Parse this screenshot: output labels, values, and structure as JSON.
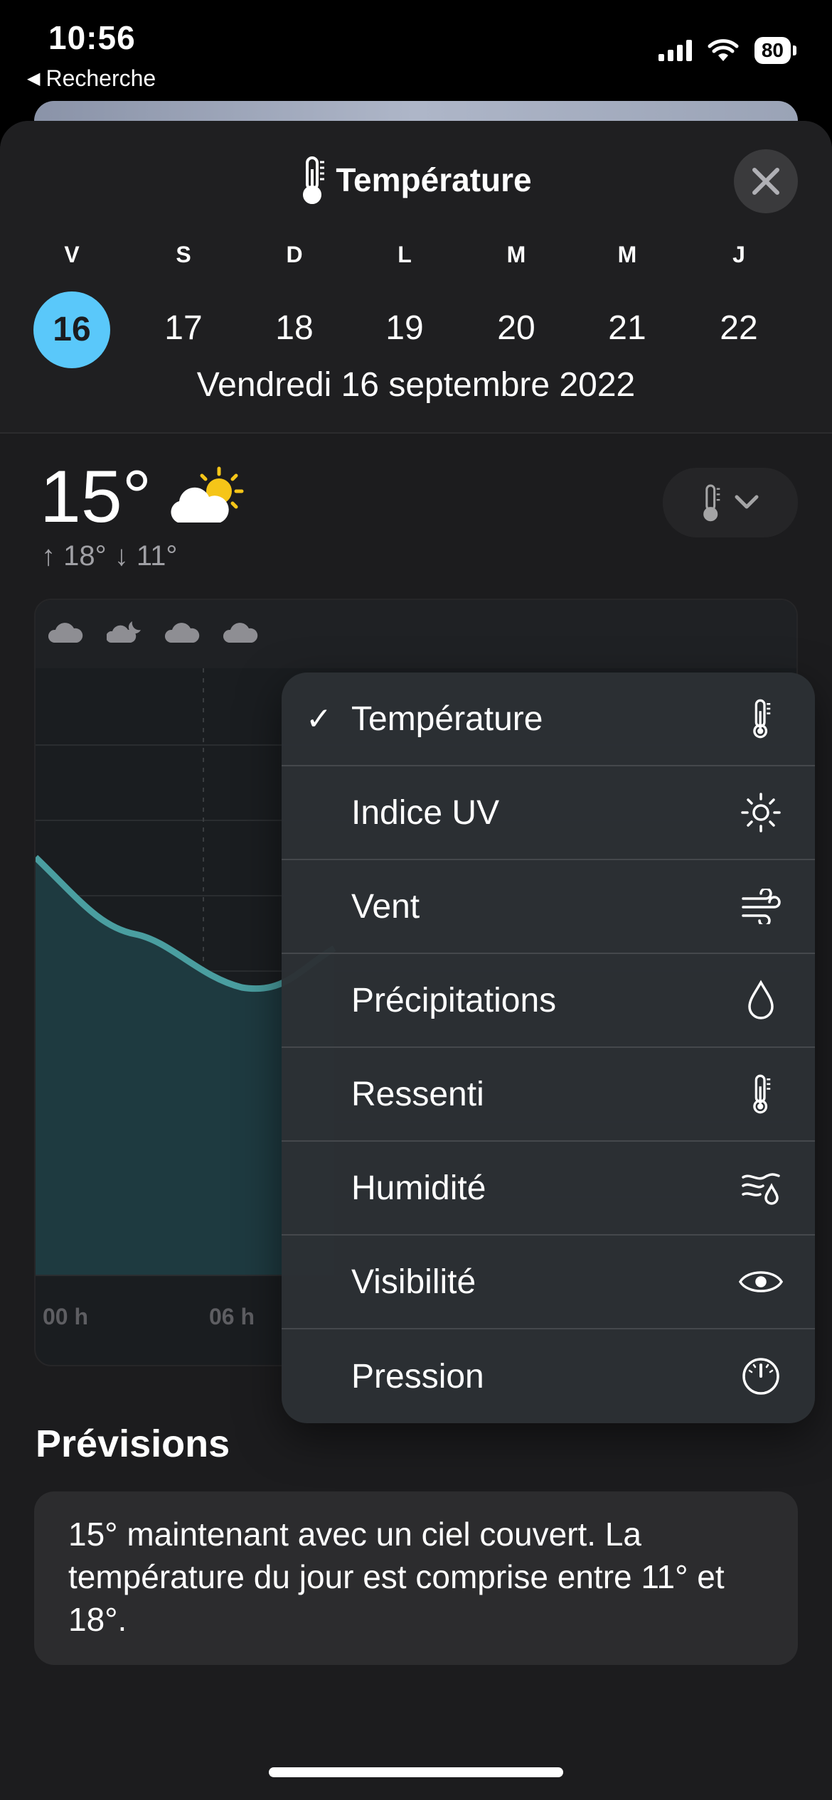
{
  "status_bar": {
    "time": "10:56",
    "back_label": "Recherche",
    "battery": "80"
  },
  "header": {
    "title": "Température",
    "title_icon": "thermometer-icon",
    "close_icon": "close-icon"
  },
  "days": [
    {
      "letter": "V",
      "number": "16",
      "selected": true
    },
    {
      "letter": "S",
      "number": "17"
    },
    {
      "letter": "D",
      "number": "18"
    },
    {
      "letter": "L",
      "number": "19"
    },
    {
      "letter": "M",
      "number": "20"
    },
    {
      "letter": "M",
      "number": "21"
    },
    {
      "letter": "J",
      "number": "22"
    }
  ],
  "date_label": "Vendredi 16 septembre 2022",
  "current": {
    "temperature": "15°",
    "high": "↑ 18°",
    "low": "↓ 11°",
    "condition_icon": "partly-cloudy-sun-icon"
  },
  "chart": {
    "x_labels": [
      "00 h",
      "06 h"
    ],
    "condition_icons": [
      "cloud-icon",
      "cloud-moon-icon",
      "cloud-icon",
      "cloud-icon"
    ],
    "line_color": "#4a9ea0"
  },
  "menu": {
    "items": [
      {
        "label": "Température",
        "icon": "thermometer-icon",
        "checked": true
      },
      {
        "label": "Indice UV",
        "icon": "sun-icon"
      },
      {
        "label": "Vent",
        "icon": "wind-icon"
      },
      {
        "label": "Précipitations",
        "icon": "drop-icon"
      },
      {
        "label": "Ressenti",
        "icon": "thermometer-icon"
      },
      {
        "label": "Humidité",
        "icon": "humidity-icon"
      },
      {
        "label": "Visibilité",
        "icon": "eye-icon"
      },
      {
        "label": "Pression",
        "icon": "gauge-icon"
      }
    ],
    "check_mark": "✓"
  },
  "previsions": {
    "title": "Prévisions",
    "text": "15° maintenant avec un ciel couvert. La température du jour est comprise entre 11° et 18°."
  },
  "colors": {
    "accent": "#5ac8fa",
    "sun": "#f5c518"
  }
}
